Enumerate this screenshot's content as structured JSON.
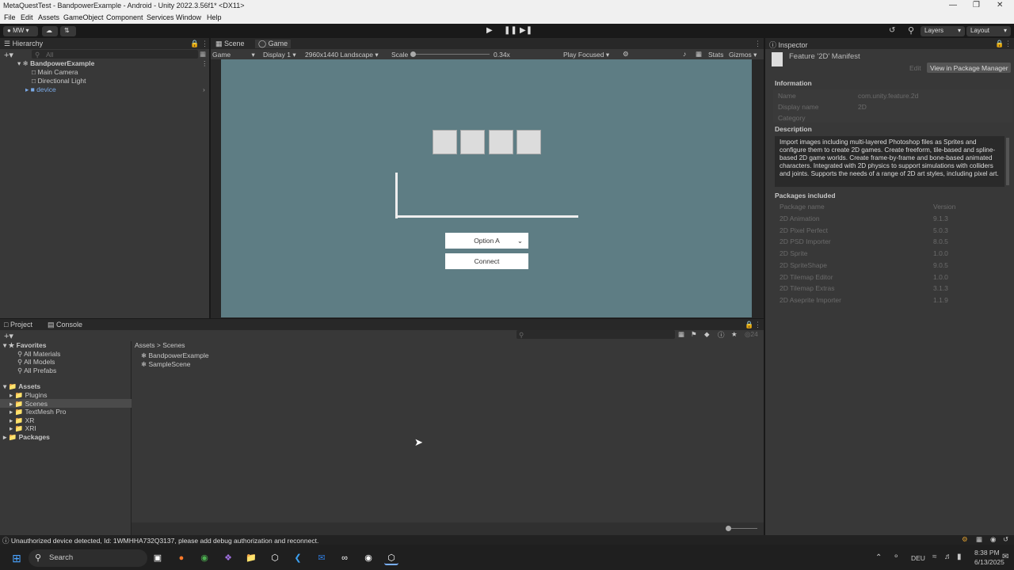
{
  "window": {
    "title": "MetaQuestTest - BandpowerExample - Android - Unity 2022.3.56f1* <DX11>"
  },
  "menu": [
    "File",
    "Edit",
    "Assets",
    "GameObject",
    "Component",
    "Services",
    "Window",
    "Help"
  ],
  "toolbar": {
    "account": "MW",
    "layers": "Layers",
    "layout": "Layout"
  },
  "hierarchy": {
    "tab": "Hierarchy",
    "search_placeholder": "All",
    "scene": "BandpowerExample",
    "items": [
      "Main Camera",
      "Directional Light",
      "device"
    ]
  },
  "scene_tabs": {
    "scene": "Scene",
    "game": "Game"
  },
  "game_bar": {
    "mode": "Game",
    "display": "Display 1",
    "resolution": "2960x1440 Landscape",
    "scale_label": "Scale",
    "scale_value": "0.34x",
    "play": "Play Focused",
    "stats": "Stats",
    "gizmos": "Gizmos"
  },
  "game_view": {
    "dropdown": "Option A",
    "connect": "Connect"
  },
  "inspector": {
    "tab": "Inspector",
    "header": "Feature '2D' Manifest",
    "edit": "Edit",
    "view_pm": "View in Package Manager",
    "information": "Information",
    "name_label": "Name",
    "name_value": "com.unity.feature.2d",
    "display_label": "Display name",
    "display_value": "2D",
    "category_label": "Category",
    "description_title": "Description",
    "description": "Import images including multi-layered Photoshop files as Sprites and configure them to create 2D games. Create freeform, tile-based and spline-based 2D game worlds. Create frame-by-frame and bone-based animated characters. Integrated with 2D physics to support simulations with colliders and joints. Supports the needs of a range of 2D art styles, including pixel art.",
    "packages_title": "Packages included",
    "col_name": "Package name",
    "col_version": "Version",
    "packages": [
      {
        "name": "2D Animation",
        "version": "9.1.3"
      },
      {
        "name": "2D Pixel Perfect",
        "version": "5.0.3"
      },
      {
        "name": "2D PSD Importer",
        "version": "8.0.5"
      },
      {
        "name": "2D Sprite",
        "version": "1.0.0"
      },
      {
        "name": "2D SpriteShape",
        "version": "9.0.5"
      },
      {
        "name": "2D Tilemap Editor",
        "version": "1.0.0"
      },
      {
        "name": "2D Tilemap Extras",
        "version": "3.1.3"
      },
      {
        "name": "2D Aseprite Importer",
        "version": "1.1.9"
      }
    ]
  },
  "project": {
    "tab_project": "Project",
    "tab_console": "Console",
    "favorites": "Favorites",
    "fav_items": [
      "All Materials",
      "All Models",
      "All Prefabs"
    ],
    "assets": "Assets",
    "asset_folders": [
      "Plugins",
      "Scenes",
      "TextMesh Pro",
      "XR",
      "XRI"
    ],
    "packages": "Packages",
    "breadcrumb_root": "Assets",
    "breadcrumb_leaf": "Scenes",
    "files": [
      "BandpowerExample",
      "SampleScene"
    ],
    "count": "24"
  },
  "status": {
    "message": "Unauthorized device detected, Id: 1WMHHA732Q3137, please add debug authorization and reconnect."
  },
  "taskbar": {
    "search": "Search",
    "lang": "DEU",
    "time": "8:38 PM",
    "date": "6/13/2025"
  }
}
